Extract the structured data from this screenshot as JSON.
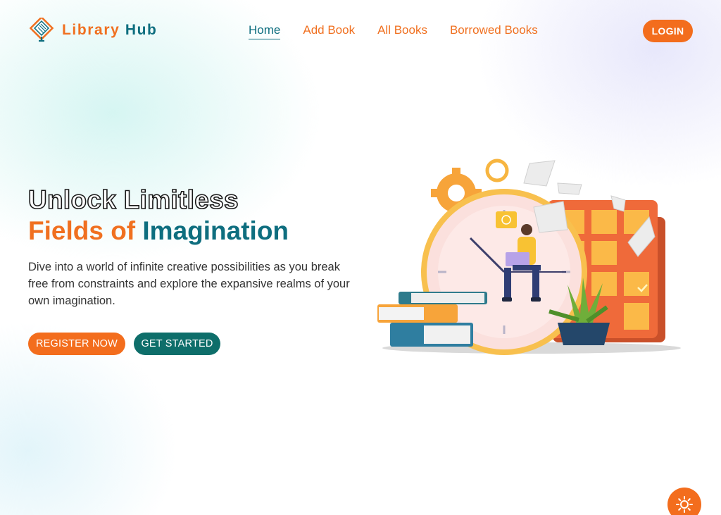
{
  "header": {
    "brand_word1": "Library",
    "brand_word2": "Hub",
    "nav": [
      {
        "label": "Home",
        "active": true
      },
      {
        "label": "Add Book",
        "active": false
      },
      {
        "label": "All Books",
        "active": false
      },
      {
        "label": "Borrowed Books",
        "active": false
      }
    ],
    "login_label": "LOGIN"
  },
  "hero": {
    "title_line1": "Unlock Limitless",
    "title_line2_part1": "Fields of",
    "title_line2_part2": "Imagination",
    "description": "Dive into a world of infinite creative possibilities as you break free from constraints and explore the expansive realms of your own imagination.",
    "register_label": "REGISTER NOW",
    "started_label": "GET STARTED"
  },
  "icons": {
    "brand_logo": "book-diamond-icon",
    "theme_toggle": "sun-icon"
  },
  "colors": {
    "accent_orange": "#f36d1d",
    "brand_teal": "#0e6e7f",
    "button_teal": "#0e6e6a"
  }
}
